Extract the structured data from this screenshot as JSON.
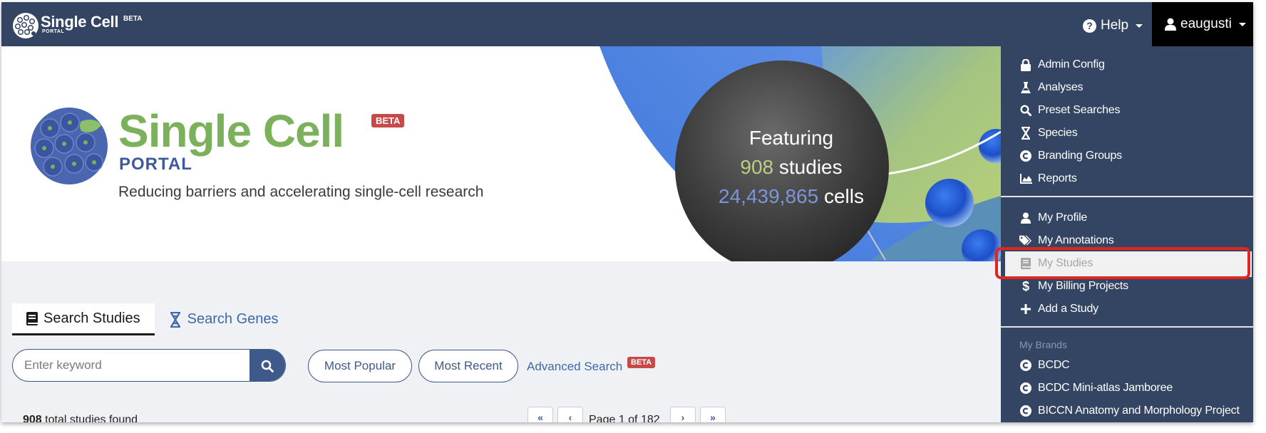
{
  "navbar": {
    "brand": "Single Cell",
    "brand_beta": "BETA",
    "brand_portal": "PORTAL",
    "help_label": "Help",
    "user_label": "eaugusti"
  },
  "banner": {
    "title": "Single Cell",
    "beta": "BETA",
    "portal": "PORTAL",
    "tagline": "Reducing barriers and accelerating single-cell research",
    "featuring": "Featuring",
    "studies_count": "908",
    "studies_label": "studies",
    "cells_count": "24,439,865",
    "cells_label": "cells"
  },
  "search": {
    "tab_studies": "Search Studies",
    "tab_genes": "Search Genes",
    "placeholder": "Enter keyword",
    "most_popular": "Most Popular",
    "most_recent": "Most Recent",
    "advanced": "Advanced Search",
    "advanced_beta": "BETA"
  },
  "results": {
    "count": "908",
    "count_label": "total studies found",
    "first": "«",
    "prev": "‹",
    "page_label": "Page 1 of 182",
    "next": "›",
    "last": "»"
  },
  "dropdown": {
    "admin_items": [
      {
        "label": "Admin Config",
        "icon": "lock-icon"
      },
      {
        "label": "Analyses",
        "icon": "flask-icon"
      },
      {
        "label": "Preset Searches",
        "icon": "search-icon"
      },
      {
        "label": "Species",
        "icon": "dna-icon"
      },
      {
        "label": "Branding Groups",
        "icon": "copyright-icon"
      },
      {
        "label": "Reports",
        "icon": "chart-area-icon"
      }
    ],
    "user_items": [
      {
        "label": "My Profile",
        "icon": "user-icon"
      },
      {
        "label": "My Annotations",
        "icon": "tags-icon"
      },
      {
        "label": "My Studies",
        "icon": "book-icon"
      },
      {
        "label": "My Billing Projects",
        "icon": "dollar-icon"
      },
      {
        "label": "Add a Study",
        "icon": "plus-icon"
      }
    ],
    "brands_header": "My Brands",
    "brands": [
      {
        "label": "BCDC",
        "icon": "copyright-icon"
      },
      {
        "label": "BCDC Mini-atlas Jamboree",
        "icon": "copyright-icon"
      },
      {
        "label": "BICCN Anatomy and Morphology Project",
        "icon": "copyright-icon"
      }
    ]
  },
  "colors": {
    "navbar": "#344563",
    "title_green": "#7cb15b",
    "portal_blue": "#3d5a9b",
    "beta_red": "#c54a48",
    "highlight_red": "#e0261f"
  }
}
